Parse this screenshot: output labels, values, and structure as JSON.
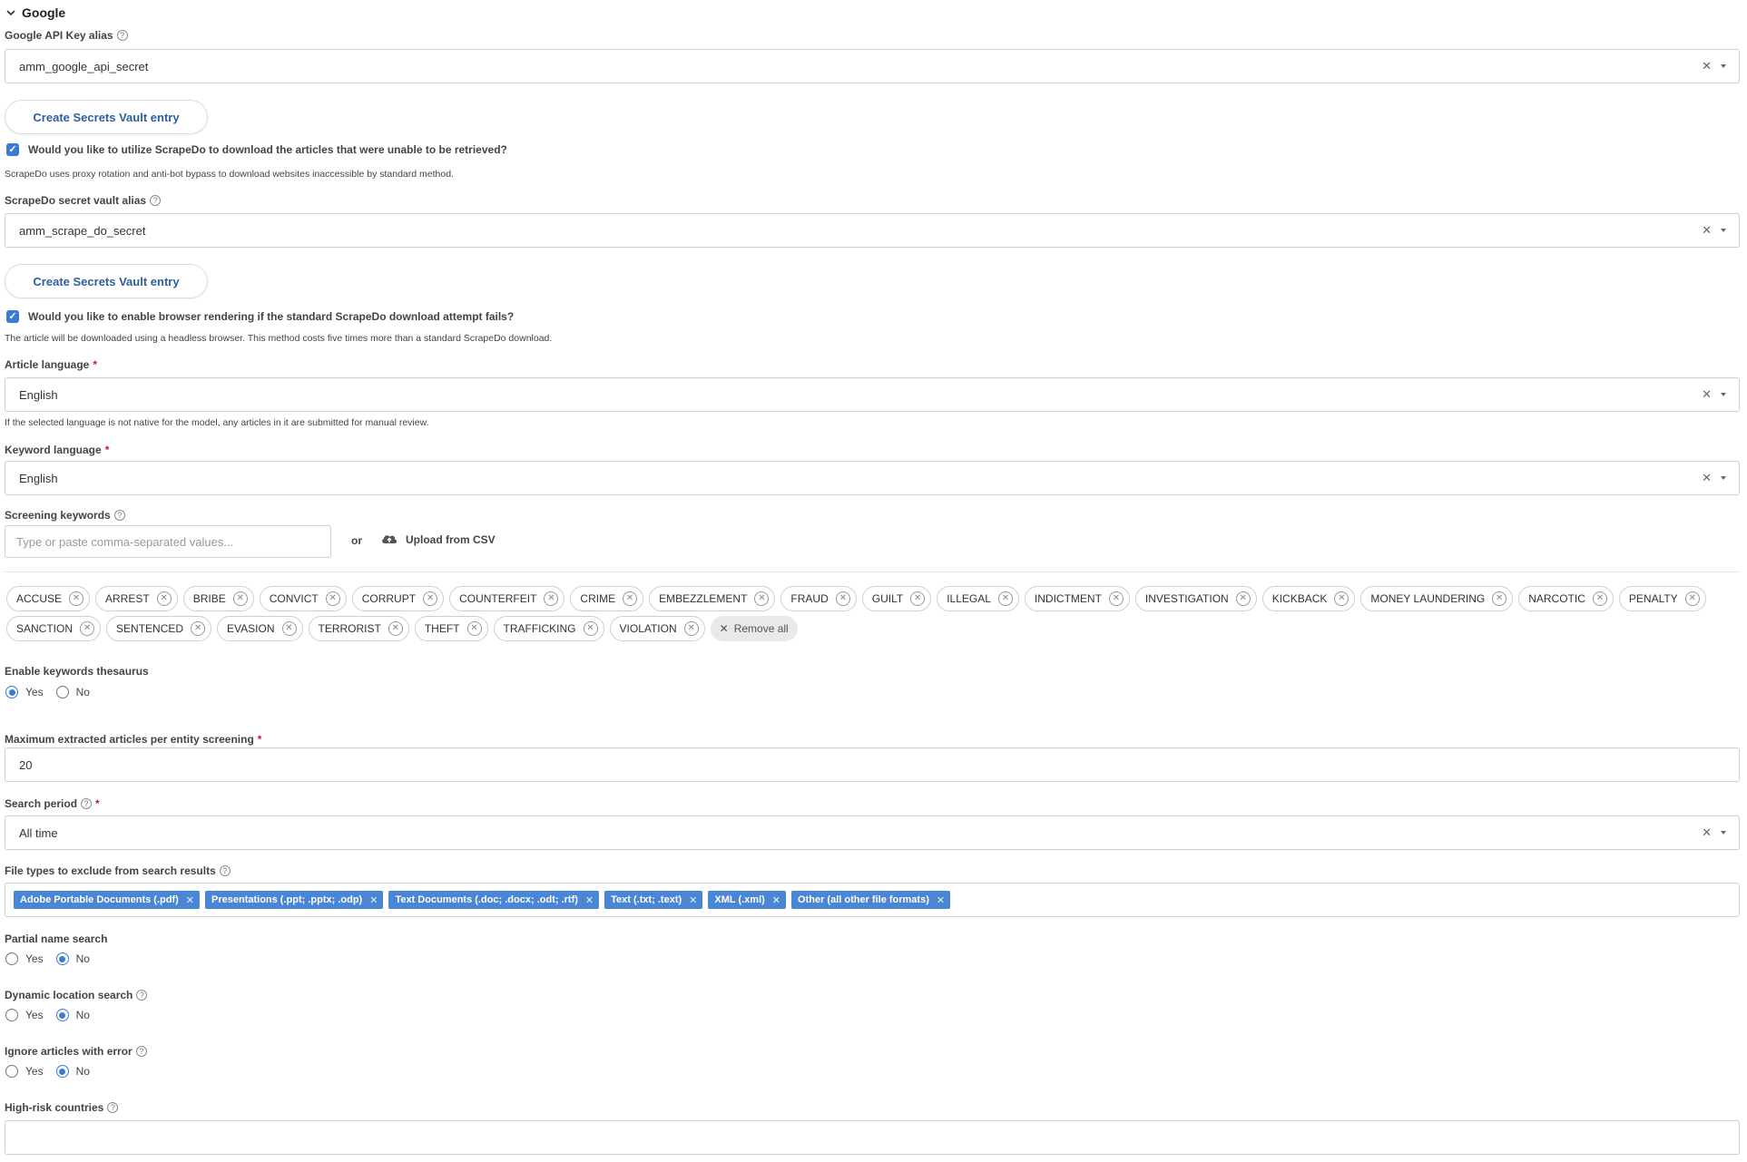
{
  "section": {
    "title": "Google"
  },
  "google_api": {
    "label": "Google API Key alias",
    "value": "amm_google_api_secret",
    "create_button": "Create Secrets Vault entry"
  },
  "scrapedo": {
    "question": "Would you like to utilize ScrapeDo to download the articles that were unable to be retrieved?",
    "help": "ScrapeDo uses proxy rotation and anti-bot bypass to download websites inaccessible by standard method.",
    "alias_label": "ScrapeDo secret vault alias",
    "alias_value": "amm_scrape_do_secret",
    "create_button": "Create Secrets Vault entry"
  },
  "browser_render": {
    "question": "Would you like to enable browser rendering if the standard ScrapeDo download attempt fails?",
    "help": "The article will be downloaded using a headless browser. This method costs five times more than a standard ScrapeDo download."
  },
  "article_language": {
    "label": "Article language",
    "value": "English",
    "help": "If the selected language is not native for the model, any articles in it are submitted for manual review."
  },
  "keyword_language": {
    "label": "Keyword language",
    "value": "English"
  },
  "screening_keywords": {
    "label": "Screening keywords",
    "placeholder": "Type or paste comma-separated values...",
    "or": "or",
    "upload": "Upload from CSV",
    "keywords": [
      "ACCUSE",
      "ARREST",
      "BRIBE",
      "CONVICT",
      "CORRUPT",
      "COUNTERFEIT",
      "CRIME",
      "EMBEZZLEMENT",
      "FRAUD",
      "GUILT",
      "ILLEGAL",
      "INDICTMENT",
      "INVESTIGATION",
      "KICKBACK",
      "MONEY LAUNDERING",
      "NARCOTIC",
      "PENALTY",
      "SANCTION",
      "SENTENCED",
      "EVASION",
      "TERRORIST",
      "THEFT",
      "TRAFFICKING",
      "VIOLATION"
    ],
    "remove_all": "Remove all"
  },
  "thesaurus": {
    "label": "Enable keywords thesaurus",
    "yes": "Yes",
    "no": "No",
    "selected": "yes"
  },
  "max_articles": {
    "label": "Maximum extracted articles per entity screening",
    "value": "20"
  },
  "search_period": {
    "label": "Search period",
    "value": "All time"
  },
  "file_types": {
    "label": "File types to exclude from search results",
    "tags": [
      "Adobe Portable Documents (.pdf)",
      "Presentations (.ppt; .pptx; .odp)",
      "Text Documents (.doc; .docx; .odt; .rtf)",
      "Text (.txt; .text)",
      "XML (.xml)",
      "Other (all other file formats)"
    ]
  },
  "partial_name": {
    "label": "Partial name search",
    "yes": "Yes",
    "no": "No",
    "selected": "no"
  },
  "dynamic_location": {
    "label": "Dynamic location search",
    "yes": "Yes",
    "no": "No",
    "selected": "no"
  },
  "ignore_errors": {
    "label": "Ignore articles with error",
    "yes": "Yes",
    "no": "No",
    "selected": "no"
  },
  "high_risk": {
    "label": "High-risk countries",
    "value": ""
  },
  "icons": {
    "clear": "✕",
    "chevron": "chevron-down-icon",
    "help": "?",
    "upload": "cloud-upload-icon"
  },
  "colors": {
    "accent": "#3a7bd5",
    "button_text": "#2e5f9c",
    "required": "#c21a37",
    "tag_bg": "#4a86d4"
  }
}
